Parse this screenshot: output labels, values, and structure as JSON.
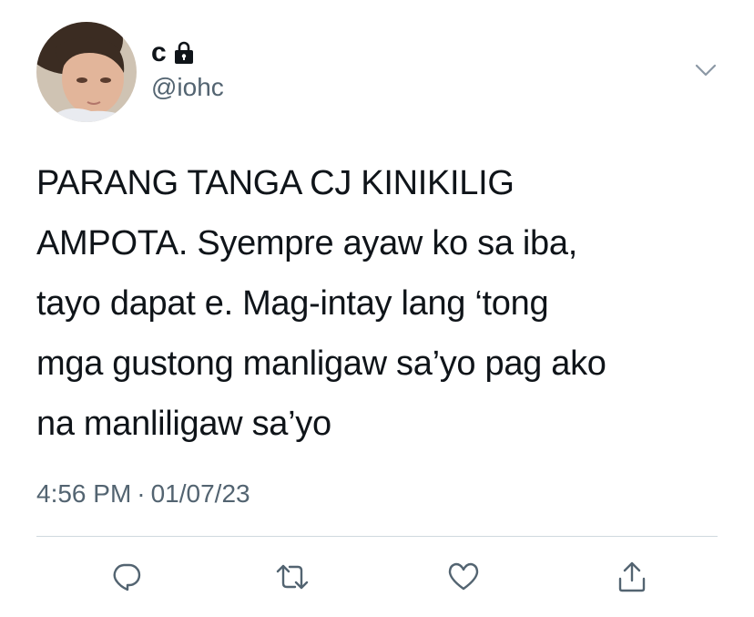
{
  "user": {
    "display_name": "c",
    "handle": "@iohc",
    "locked_icon": "lock-icon",
    "avatar": "avatar"
  },
  "tweet": {
    "text_lines": [
      "PARANG TANGA CJ KINIKILIG",
      "AMPOTA. Syempre ayaw ko sa iba,",
      "tayo dapat e. Mag-intay lang ‘tong",
      "mga gustong manligaw sa’yo pag ako",
      "na manliligaw sa’yo"
    ],
    "time": "4:56 PM",
    "separator": "·",
    "date": "01/07/23"
  },
  "actions": [
    {
      "name": "reply",
      "icon": "reply-icon"
    },
    {
      "name": "retweet",
      "icon": "retweet-icon"
    },
    {
      "name": "like",
      "icon": "heart-icon"
    },
    {
      "name": "share",
      "icon": "share-icon"
    }
  ],
  "menu": {
    "icon": "chevron-down-icon"
  },
  "colors": {
    "text": "#0f1419",
    "secondary": "#536471",
    "divider": "#cfd9de",
    "background": "#ffffff"
  }
}
